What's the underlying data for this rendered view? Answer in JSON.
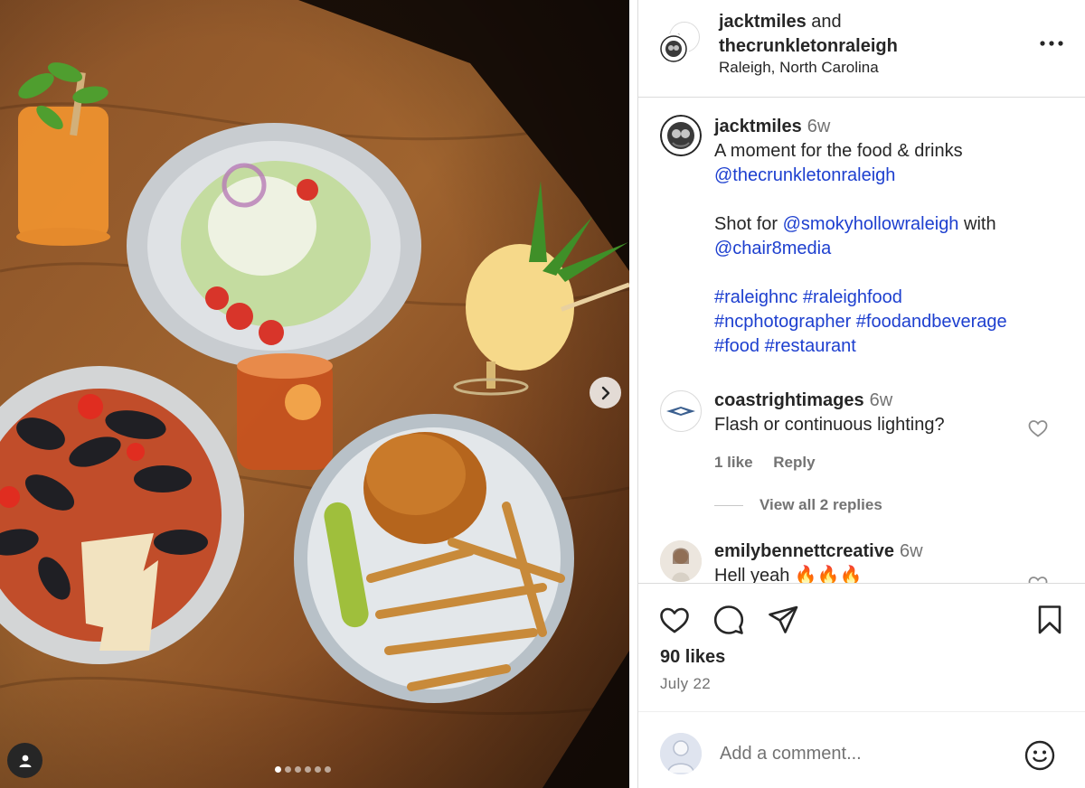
{
  "media": {
    "slide_count": 6,
    "active_slide": 1,
    "next_icon": "chevron-right-icon",
    "user_tag_icon": "person-icon"
  },
  "header": {
    "author": "jacktmiles",
    "conjunction": "and",
    "collaborator": "thecrunkletonraleigh",
    "location": "Raleigh, North Carolina",
    "more_icon": "more-horizontal-icon"
  },
  "caption": {
    "username": "jacktmiles",
    "time": "6w",
    "line1": "A moment for the food & drinks",
    "mention1": "@thecrunkletonraleigh",
    "shot_for": "Shot for",
    "mention2": "@smokyhollowraleigh",
    "with": "with",
    "mention3": "@chair8media",
    "hashtags_line1": "#raleighnc #raleighfood",
    "hashtags_line2": "#ncphotographer #foodandbeverage",
    "hashtags_line3": "#food #restaurant"
  },
  "comments": [
    {
      "username": "coastrightimages",
      "time": "6w",
      "text": "Flash or continuous lighting?",
      "likes": "1 like",
      "reply": "Reply",
      "view_replies": "View all 2 replies"
    },
    {
      "username": "emilybennettcreative",
      "time": "6w",
      "text": "Hell yeah 🔥🔥🔥"
    }
  ],
  "actions": {
    "like_icon": "heart-icon",
    "comment_icon": "comment-icon",
    "share_icon": "paper-plane-icon",
    "save_icon": "bookmark-icon",
    "likes": "90 likes",
    "date": "July 22"
  },
  "add_comment": {
    "placeholder": "Add a comment...",
    "emoji_icon": "smiley-icon"
  },
  "colors": {
    "link": "#1d3fcf",
    "muted": "#737373",
    "border": "#dbdbdb",
    "text": "#262626"
  }
}
